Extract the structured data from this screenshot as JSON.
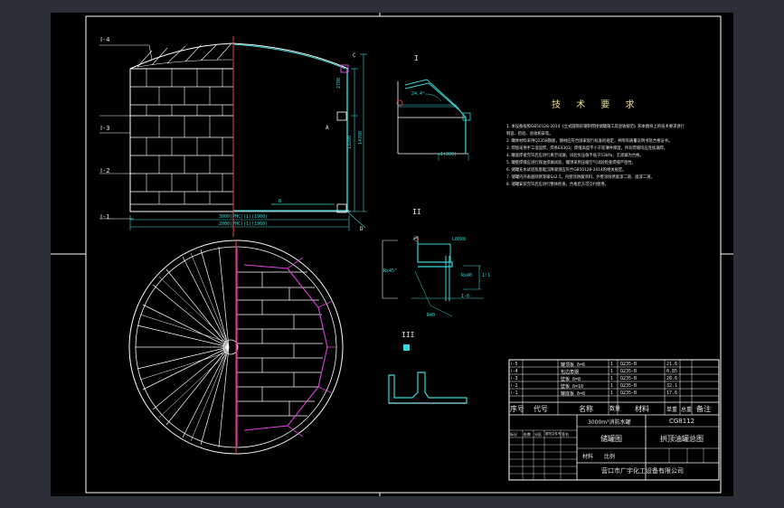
{
  "colors": {
    "background": "#2a2f38",
    "paper": "#000000",
    "border": "#ffffff",
    "section": "#f04040",
    "dimension": "#3ad6d6",
    "hidden": "#e040e0",
    "steel": "#3ad6d6",
    "text": "#e8e8e8"
  },
  "view_markers": {
    "i": "I",
    "ii": "II",
    "iii": "III"
  },
  "elevation": {
    "levels": [
      "Ⅰ-4",
      "Ⅰ-3",
      "Ⅰ-2",
      "Ⅰ-1"
    ],
    "dim_width_1": "3000(PHC)(1)(1960)",
    "dim_width_2": "2000(PHC)(1)(1960)",
    "dim_h1": "2780",
    "dim_h2": "13280",
    "dim_h3": "14780",
    "label_c": "C",
    "label_a": "A",
    "label_b": "B",
    "label_right": "D"
  },
  "detail_i": {
    "angle": "24.4°",
    "note": "≈1(200)"
  },
  "detail_ii": {
    "note1": "L80X8",
    "note2": "Rx45°",
    "note3": "Rx40",
    "note4": "1:1",
    "note5": "I-6",
    "note6": "R40"
  },
  "tech": {
    "title": "技 术 要 求",
    "notes": [
      "1. 本设备按照GB50128-2014《立式圆筒形钢制焊接储罐施工及验收规范》和本图样上的技术要求进行",
      "   制造、检验、验收和安装。",
      "2. 罐体材料采用Q235B钢板，钢材应符合国家现行标准的规定，并附有质量证明书及合格证书。",
      "3. 焊接采用手工电弧焊，焊条E4303；焊缝高度不小于较薄件厚度，所有焊缝均应连续满焊。",
      "4. 罐底焊接完毕后应进行真空试漏，试验负压值不低于53kPa，无渗漏为合格。",
      "5. 罐壁焊缝应进行煤油渗漏试验，罐顶采用压缩空气试验检查焊缝严密性。",
      "6. 储罐充水试验及基础沉降观测应符合GB50128-2014的相关规定。",
      "7. 储罐内外表面除锈等级Sa2.5，内壁涂防腐涂料，外壁涂防锈底漆二道、面漆二道。",
      "8. 储罐安装完毕后应进行整体检查，合格后方可交付使用。"
    ]
  },
  "bom": {
    "rows": [
      {
        "no": "Ⅰ-5",
        "code": "",
        "name": "罐顶板 δ=6",
        "qty": "1",
        "mat": "Q235-B",
        "wt": "21.6"
      },
      {
        "no": "Ⅰ-4",
        "code": "",
        "name": "包边角钢",
        "qty": "1",
        "mat": "Q235-B",
        "wt": "0.85"
      },
      {
        "no": "Ⅰ-3",
        "code": "",
        "name": "壁板 δ=8",
        "qty": "1",
        "mat": "Q235-B",
        "wt": "28.6"
      },
      {
        "no": "Ⅰ-2",
        "code": "",
        "name": "壁板 δ=10",
        "qty": "1",
        "mat": "Q235-B",
        "wt": "32.1"
      },
      {
        "no": "Ⅰ-1",
        "code": "",
        "name": "罐底板 δ=8",
        "qty": "1",
        "mat": "Q235-B",
        "wt": "17.6"
      }
    ],
    "headers": [
      "序号",
      "代号",
      "名称",
      "数量",
      "材料",
      "单重",
      "总重",
      "备注"
    ]
  },
  "titleblock": {
    "project": "3000m³消防水罐",
    "drawing_no": "CG8112",
    "view_title": "储罐图",
    "drawing_title": "拱顶油罐总图",
    "unit_label": "材料",
    "ratio_label": "比例",
    "company": "营口市广宇化工设备有限公司",
    "sub_row": [
      "标记",
      "处数",
      "分区",
      "更改文件号",
      "签名",
      "年月日"
    ]
  }
}
